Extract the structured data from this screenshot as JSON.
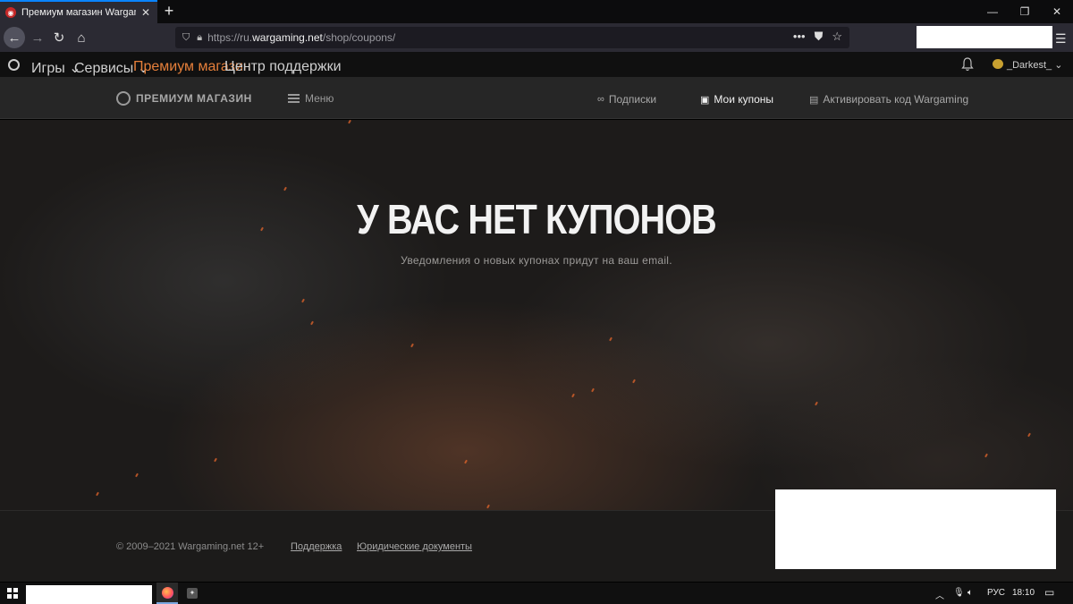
{
  "browser": {
    "tab_title": "Премиум магазин Wargaming",
    "new_tab": "+",
    "url_scheme": "https://ru.",
    "url_host": "wargaming.net",
    "url_path": "/shop/coupons/"
  },
  "wg_topbar": {
    "games": "Игры ⌄",
    "services": "Сервисы ⌄",
    "premium_shop": "Премиум магазин",
    "support_center": "Центр поддержки",
    "username": "_Darkest_ ⌄"
  },
  "shop_header": {
    "logo_text": "ПРЕМИУМ МАГАЗИН",
    "menu": "Меню",
    "subscriptions": "Подписки",
    "my_coupons": "Мои купоны",
    "activate_code": "Активировать код Wargaming"
  },
  "hero": {
    "title": "У ВАС НЕТ КУПОНОВ",
    "subtitle": "Уведомления о новых купонах придут на ваш email."
  },
  "footer": {
    "copyright": "© 2009–2021 Wargaming.net 12+",
    "support": "Поддержка",
    "legal": "Юридические документы"
  },
  "taskbar": {
    "language": "РУС",
    "time": "18:10"
  },
  "colors": {
    "accent_orange": "#e57f3a",
    "tab_highlight": "#0a84ff"
  }
}
